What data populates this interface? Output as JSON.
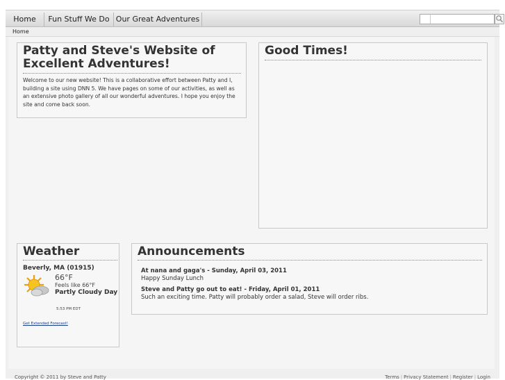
{
  "nav": {
    "items": [
      "Home",
      "Fun Stuff We Do",
      "Our Great Adventures"
    ],
    "search_placeholder": ""
  },
  "breadcrumb": "Home",
  "intro": {
    "title": "Patty and Steve's Website of Excellent Adventures!",
    "text": "Welcome to our new website!  This is a collaborative effort between Patty and I, building a site using DNN 5.  We have pages on some of our activities, as well as an extensive photo gallery of all our wonderful adventures.  I hope you enjoy the site and come back soon."
  },
  "good_times": {
    "title": "Good Times!"
  },
  "weather": {
    "title": "Weather",
    "location": "Beverly, MA (01915)",
    "temperature": "66°F",
    "feels_like": "Feels like 66°F",
    "condition": "Partly Cloudy Day",
    "time": "5:53 PM EDT",
    "forecast_link": "Get Extended Forecast!",
    "icon": "partly-cloudy-icon"
  },
  "announcements": {
    "title": "Announcements",
    "items": [
      {
        "heading": "At nana and gaga's - Sunday, April 03, 2011",
        "body": "Happy Sunday Lunch"
      },
      {
        "heading": "Steve and Patty go out to eat! - Friday, April 01, 2011",
        "body": "Such an exciting time.  Patty will probably order a salad, Steve will order ribs."
      }
    ]
  },
  "footer": {
    "copyright": "Copyright © 2011 by Steve and Patty",
    "links": [
      "Terms",
      "Privacy Statement",
      "Register",
      "Login"
    ]
  }
}
